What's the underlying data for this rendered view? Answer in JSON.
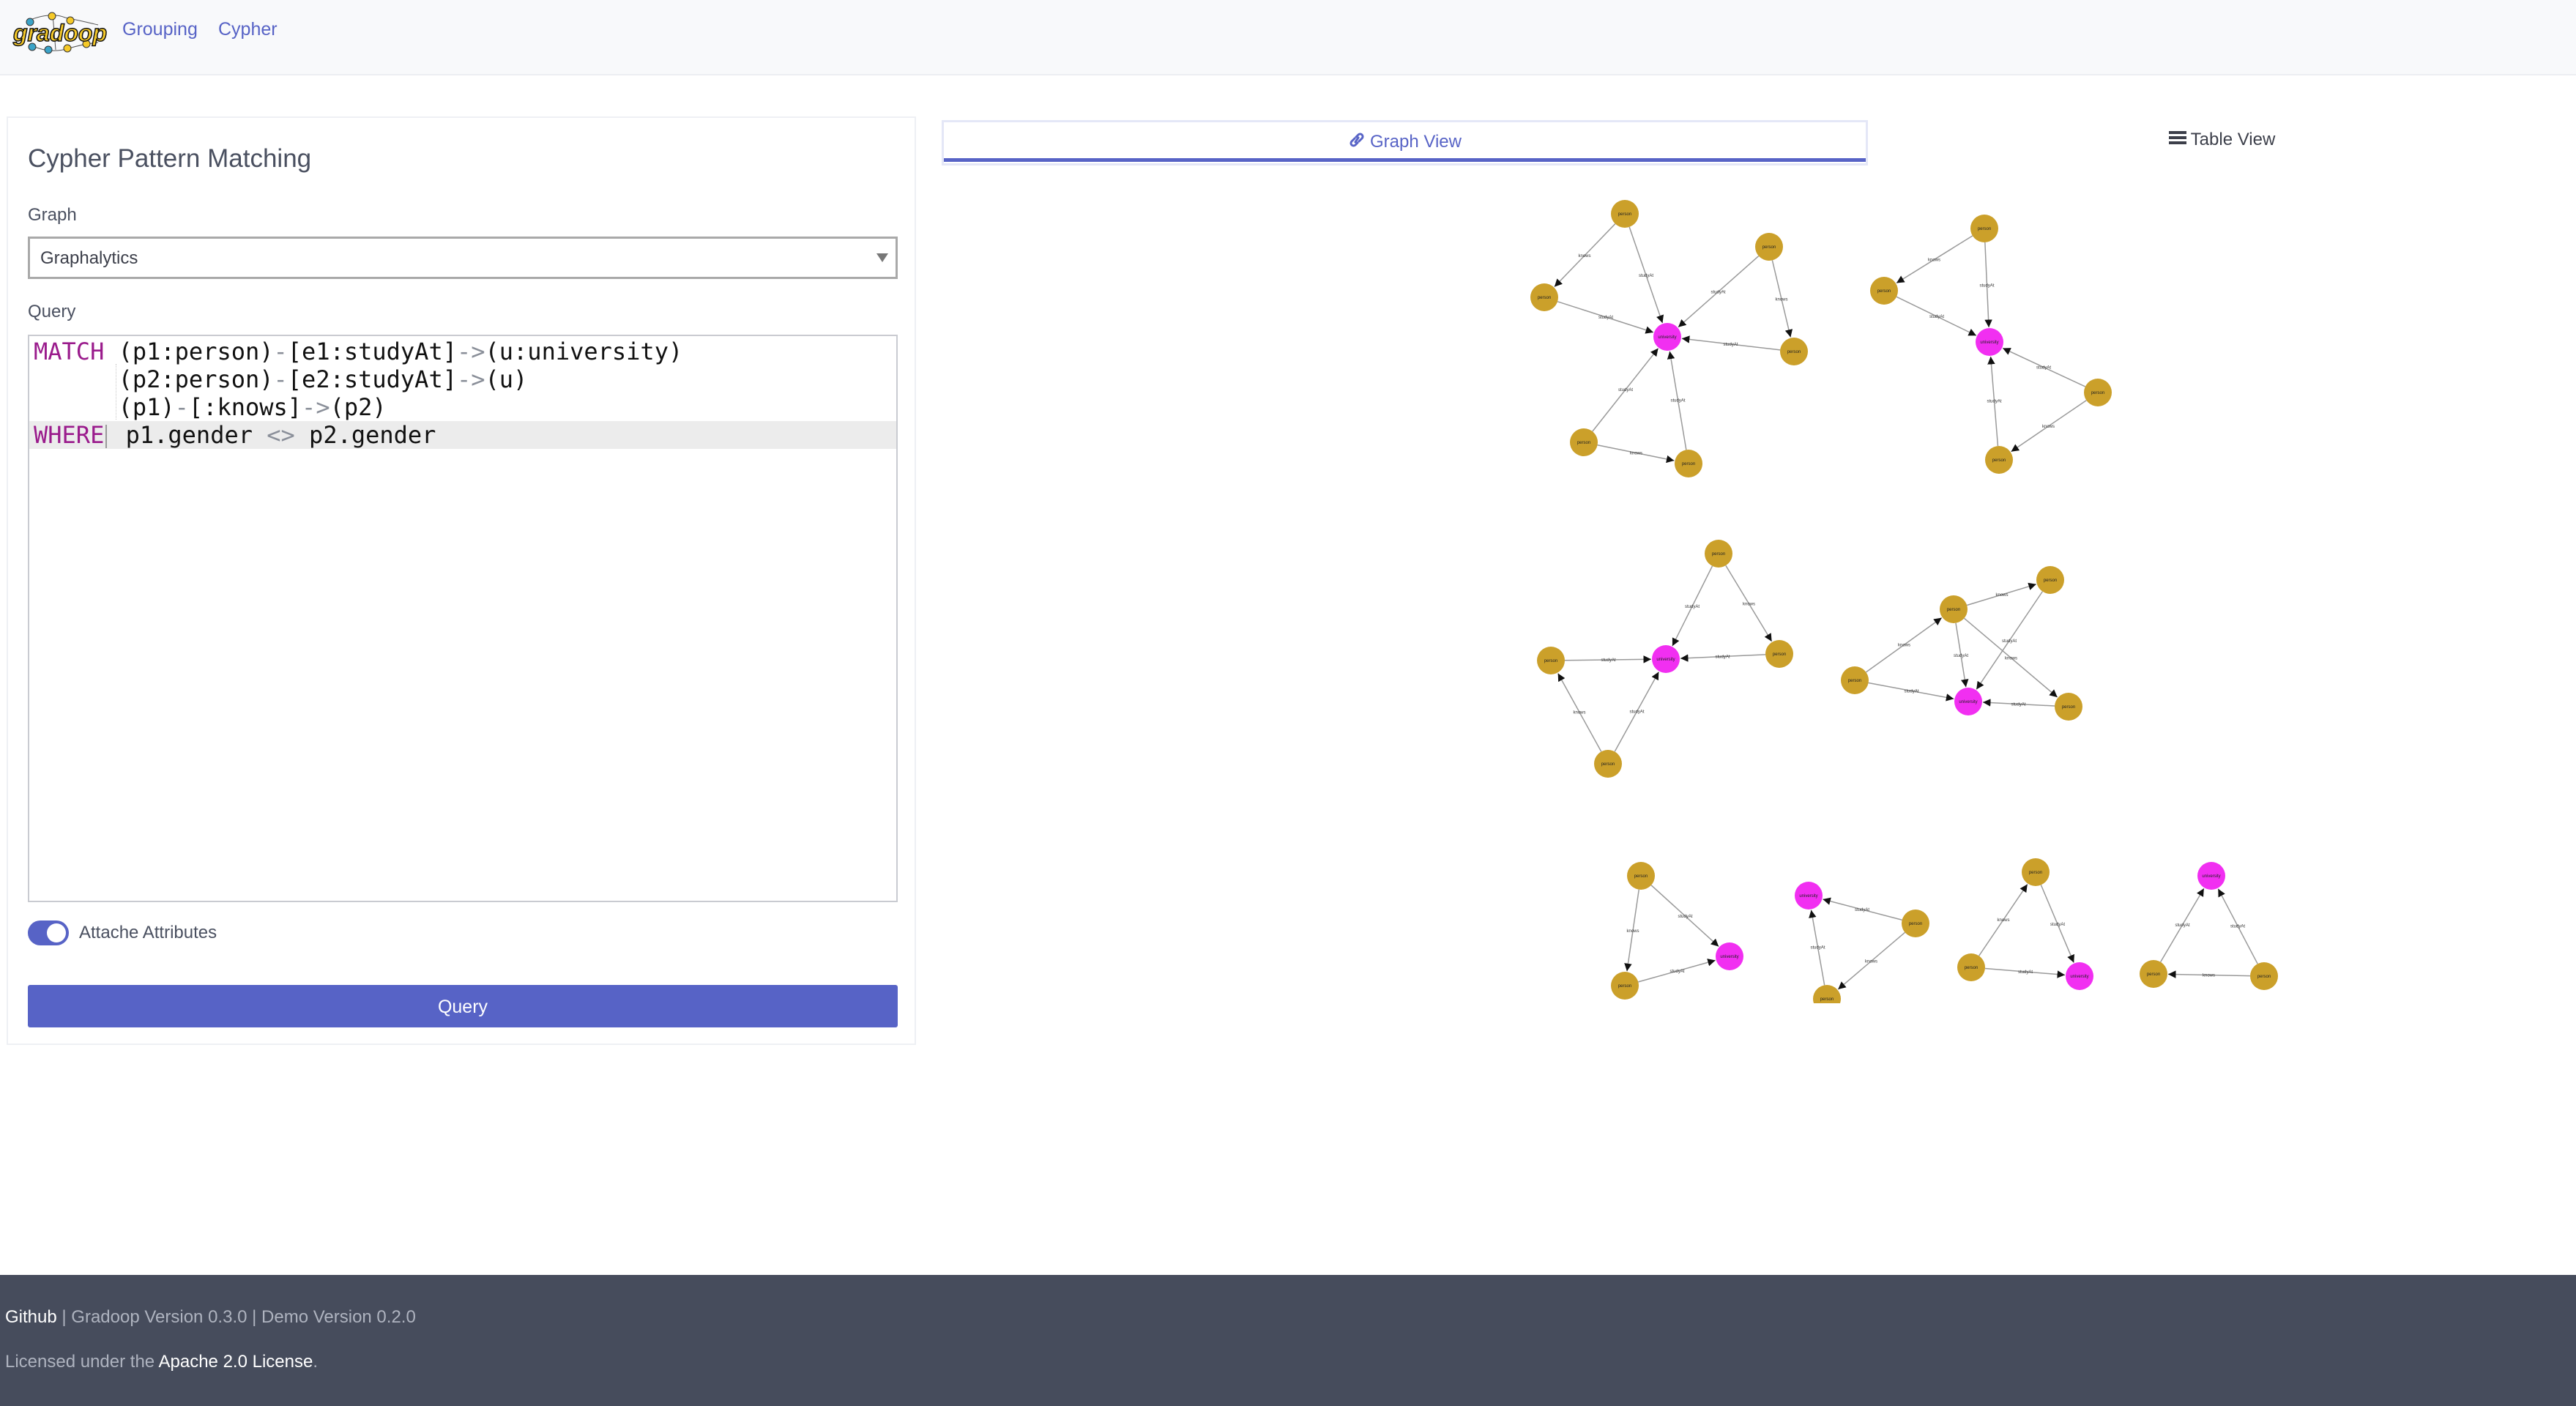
{
  "navbar": {
    "logo_text": "gradoop",
    "links": [
      {
        "label": "Grouping"
      },
      {
        "label": "Cypher"
      }
    ]
  },
  "query_panel": {
    "title": "Cypher Pattern Matching",
    "graph_label": "Graph",
    "graph_selected": "Graphalytics",
    "query_label": "Query",
    "query_lines": [
      {
        "keyword": "MATCH",
        "text": " (p1:person)-[e1:studyAt]->(u:university)"
      },
      {
        "keyword": "",
        "text": "      (p2:person)-[e2:studyAt]->(u)"
      },
      {
        "keyword": "",
        "text": "      (p1)-[:knows]->(p2)"
      },
      {
        "keyword": "WHERE",
        "text": " p1.gender <> p2.gender"
      }
    ],
    "attach_attributes_label": "Attache Attributes",
    "attach_attributes_on": true,
    "query_button": "Query"
  },
  "tabs": [
    {
      "label": "Graph View",
      "icon": "link-icon",
      "active": true
    },
    {
      "label": "Table View",
      "icon": "list-icon",
      "active": false
    }
  ],
  "graph_view": {
    "colors": {
      "person": "#cba02a",
      "university": "#f12ff1",
      "edge": "#9a9a9a",
      "accent": "#5763c6"
    },
    "edge_labels": {
      "studyAt": "studyAt",
      "knows": "knows"
    },
    "node_labels": {
      "person": "person",
      "university": "university"
    },
    "result_graphs": [
      {
        "nodes": [
          "university",
          "person",
          "person",
          "person",
          "person",
          "person",
          "person"
        ],
        "edges": [
          [
            1,
            0,
            "studyAt"
          ],
          [
            2,
            0,
            "studyAt"
          ],
          [
            3,
            0,
            "studyAt"
          ],
          [
            4,
            0,
            "studyAt"
          ],
          [
            5,
            0,
            "studyAt"
          ],
          [
            6,
            0,
            "studyAt"
          ],
          [
            1,
            2,
            "knows"
          ],
          [
            3,
            4,
            "knows"
          ],
          [
            5,
            6,
            "knows"
          ]
        ]
      },
      {
        "nodes": [
          "university",
          "person",
          "person",
          "person",
          "person"
        ],
        "edges": [
          [
            1,
            0,
            "studyAt"
          ],
          [
            2,
            0,
            "studyAt"
          ],
          [
            3,
            0,
            "studyAt"
          ],
          [
            4,
            0,
            "studyAt"
          ],
          [
            1,
            2,
            "knows"
          ],
          [
            3,
            4,
            "knows"
          ]
        ]
      },
      {
        "nodes": [
          "university",
          "person",
          "person",
          "person",
          "person"
        ],
        "edges": [
          [
            1,
            0,
            "studyAt"
          ],
          [
            2,
            0,
            "studyAt"
          ],
          [
            3,
            0,
            "studyAt"
          ],
          [
            4,
            0,
            "studyAt"
          ],
          [
            1,
            2,
            "knows"
          ],
          [
            4,
            3,
            "knows"
          ]
        ]
      },
      {
        "nodes": [
          "university",
          "person",
          "person",
          "person",
          "person"
        ],
        "edges": [
          [
            1,
            0,
            "studyAt"
          ],
          [
            2,
            0,
            "studyAt"
          ],
          [
            3,
            0,
            "studyAt"
          ],
          [
            4,
            0,
            "studyAt"
          ],
          [
            3,
            1,
            "knows"
          ],
          [
            1,
            2,
            "knows"
          ],
          [
            1,
            4,
            "knows"
          ]
        ]
      },
      {
        "nodes": [
          "person",
          "university",
          "person"
        ],
        "edges": [
          [
            0,
            1,
            "studyAt"
          ],
          [
            2,
            1,
            "studyAt"
          ],
          [
            0,
            2,
            "knows"
          ]
        ]
      },
      {
        "nodes": [
          "university",
          "person",
          "person"
        ],
        "edges": [
          [
            1,
            0,
            "studyAt"
          ],
          [
            2,
            0,
            "studyAt"
          ],
          [
            1,
            2,
            "knows"
          ]
        ]
      },
      {
        "nodes": [
          "person",
          "person",
          "university"
        ],
        "edges": [
          [
            0,
            2,
            "studyAt"
          ],
          [
            1,
            2,
            "studyAt"
          ],
          [
            1,
            0,
            "knows"
          ]
        ]
      },
      {
        "nodes": [
          "university",
          "person",
          "person"
        ],
        "edges": [
          [
            1,
            0,
            "studyAt"
          ],
          [
            2,
            0,
            "studyAt"
          ],
          [
            2,
            1,
            "knows"
          ]
        ]
      }
    ]
  },
  "footer": {
    "github": "Github",
    "versions": " | Gradoop Version 0.3.0 | Demo Version 0.2.0",
    "license_prefix": "Licensed under the ",
    "license_link": "Apache 2.0 License",
    "license_suffix": "."
  }
}
